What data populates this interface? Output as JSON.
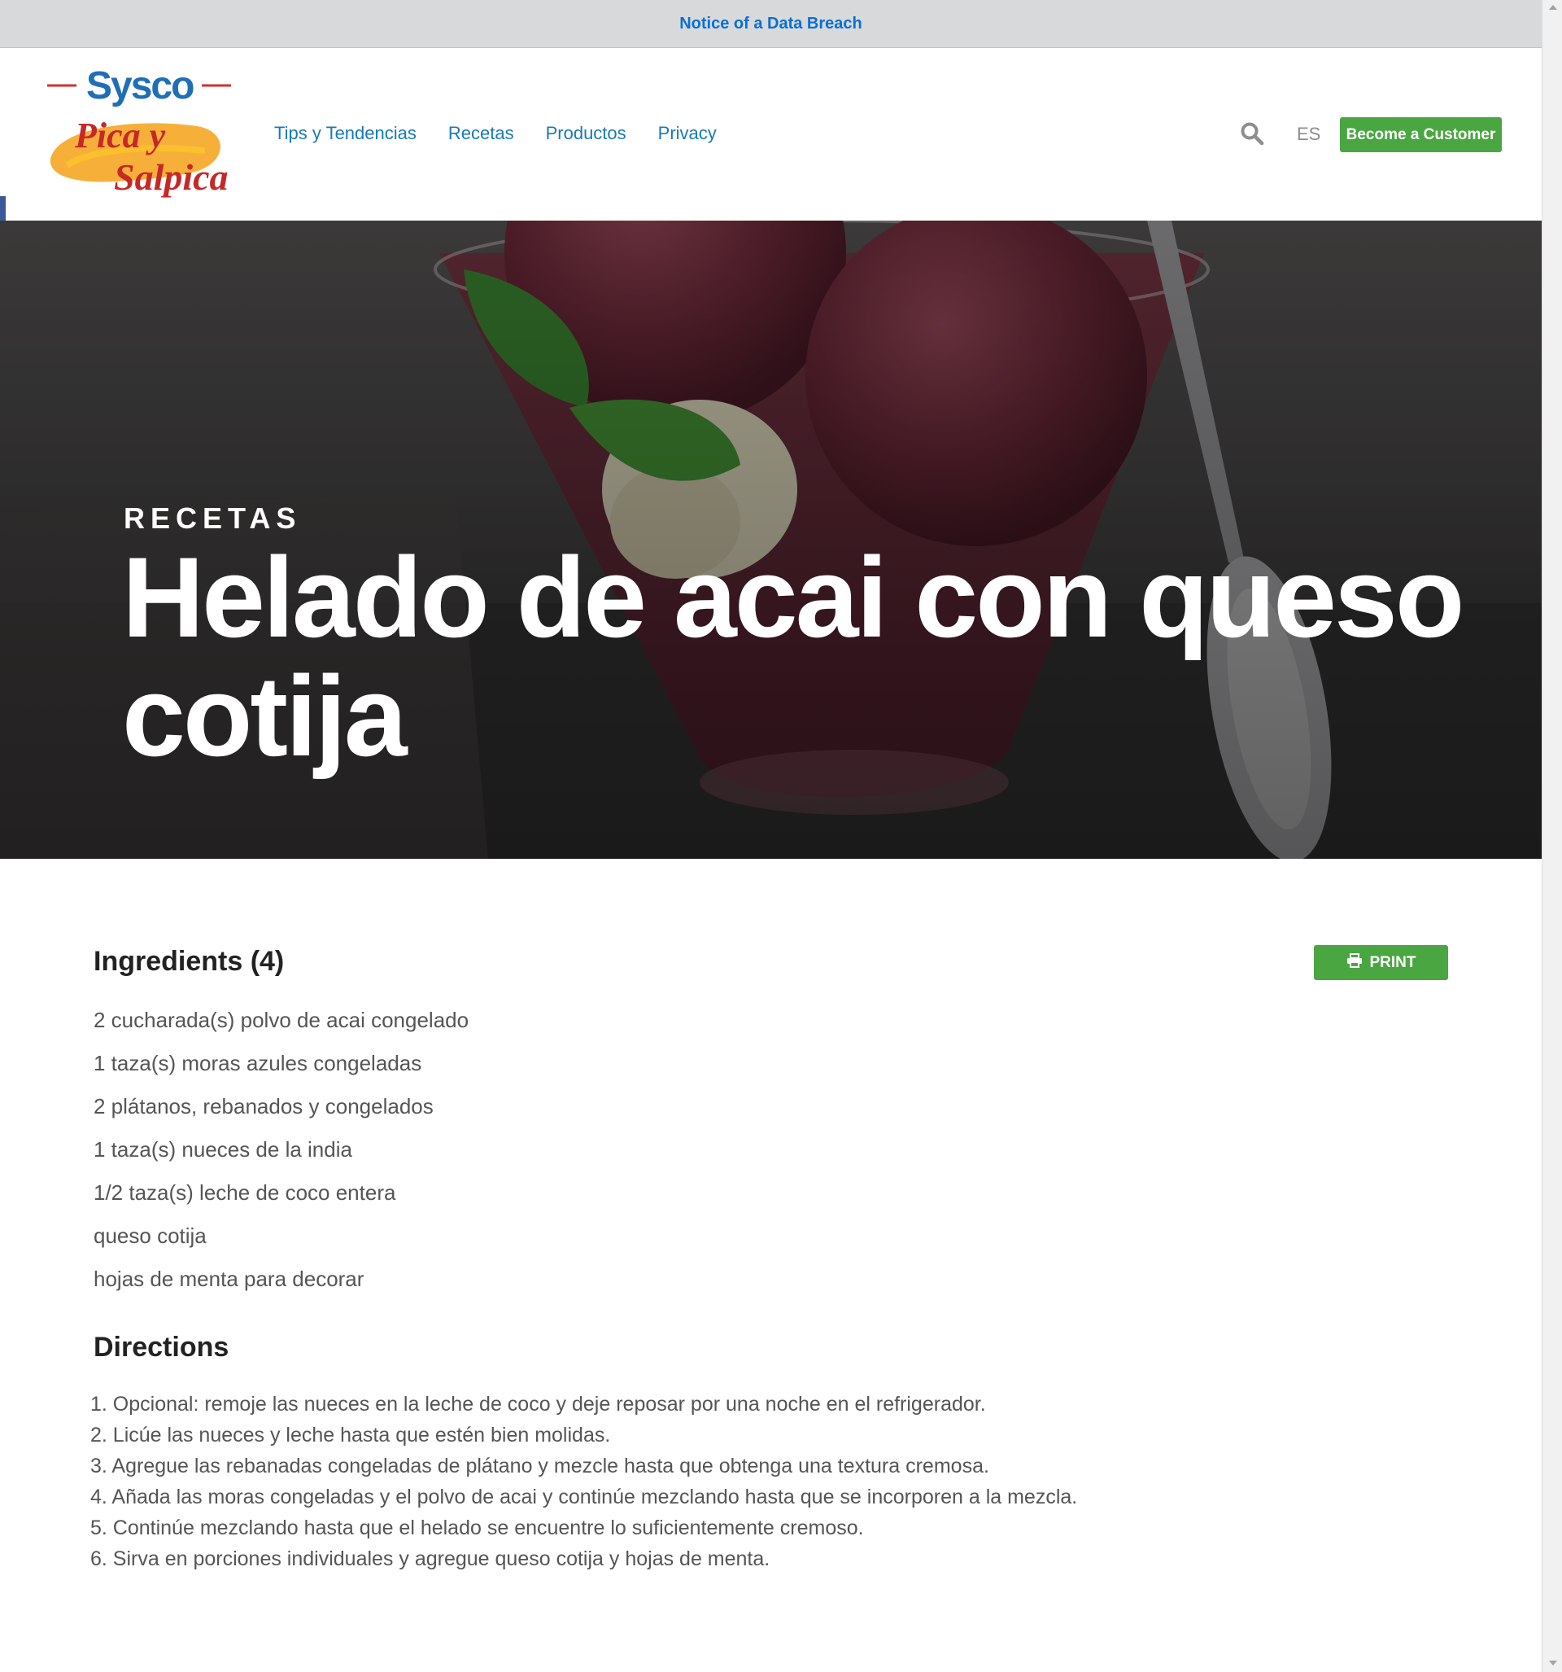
{
  "notice": {
    "text": "Notice of a Data Breach"
  },
  "logo": {
    "brand": "Sysco",
    "line1": "Pica y",
    "line2": "Salpica"
  },
  "nav": {
    "items": [
      "Tips y Tendencias",
      "Recetas",
      "Productos",
      "Privacy"
    ]
  },
  "header": {
    "search_icon": "search-icon",
    "language": "ES",
    "cta": "Become a Customer"
  },
  "social": {
    "colors": [
      "#3b5998",
      "#111111",
      "#d32f2f",
      "#ffffff",
      "#8cc63f"
    ]
  },
  "hero": {
    "kicker": "RECETAS",
    "title": "Helado de acai con queso cotija"
  },
  "recipe": {
    "ingredients_title": "Ingredients (4)",
    "print_label": "PRINT",
    "ingredients": [
      "2 cucharada(s) polvo de acai congelado",
      "1 taza(s) moras azules congeladas",
      "2 plátanos, rebanados y congelados",
      "1 taza(s) nueces de la india",
      "1/2 taza(s) leche de coco entera",
      "queso cotija",
      "hojas de menta para decorar"
    ],
    "directions_title": "Directions",
    "directions": [
      "1. Opcional: remoje las nueces en la leche de coco y deje reposar por una noche en el refrigerador.",
      "2. Licúe las nueces y leche hasta que estén bien molidas.",
      "3. Agregue las rebanadas congeladas de plátano y mezcle hasta que obtenga una textura cremosa.",
      "4. Añada las moras congeladas y el polvo de acai y continúe mezclando hasta que se incorporen a la mezcla.",
      "5. Continúe mezclando hasta que el helado se encuentre lo suficientemente cremoso.",
      "6. Sirva en porciones individuales y agregue queso cotija y hojas de menta."
    ]
  },
  "colors": {
    "accent_green": "#4aa641",
    "link_blue": "#1779b8",
    "notice_blue": "#0b6fd1"
  }
}
